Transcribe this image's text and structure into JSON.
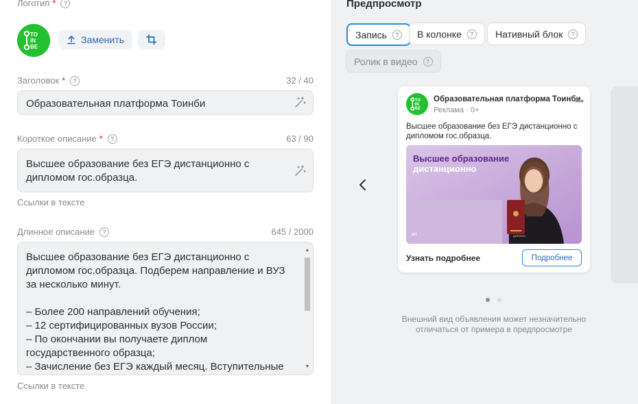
{
  "form": {
    "logo": {
      "label": "Логотип",
      "required_mark": "*",
      "replace_label": "Заменить",
      "logo_text": [
        "TO",
        "IN",
        "BE"
      ]
    },
    "title": {
      "label": "Заголовок",
      "required_mark": "*",
      "counter": "32 / 40",
      "value": "Образовательная платформа Тоинби"
    },
    "short": {
      "label": "Короткое описание",
      "required_mark": "*",
      "counter": "63 / 90",
      "value_lines": [
        "Высшее образование без ЕГЭ дистанционно с",
        "дипломом гос.образца."
      ],
      "links_label": "Ссылки в тексте"
    },
    "long": {
      "label": "Длинное описание",
      "counter": "645 / 2000",
      "value_lines": [
        "Высшее образование без ЕГЭ дистанционно с",
        "дипломом гос.образца. Подберем направление и ВУЗ",
        "за несколько минут.",
        "",
        "– Более 200 направлений обучения;",
        "– 12 сертифицированных вузов России;",
        "– По окончании вы получаете диплом",
        "государственного образца;",
        "– Зачисление без ЕГЭ каждый месяц. Вступительные"
      ],
      "links_label": "Ссылки в тексте"
    },
    "help_glyph": "?"
  },
  "preview": {
    "title": "Предпросмотр",
    "tabs": [
      {
        "label": "Запись",
        "active": true
      },
      {
        "label": "В колонке",
        "active": false
      },
      {
        "label": "Нативный блок",
        "active": false
      },
      {
        "label": "Ролик в видео",
        "active": false,
        "disabled": true
      }
    ],
    "card": {
      "advertiser": "Образовательная платформа Тоинби",
      "meta": "Реклама · 0+",
      "more_glyph": "•••",
      "text": "Высшее образование без ЕГЭ дистанционно с дипломом гос.образца.",
      "image_caption_lines": [
        "Высшее образование",
        "дистанционно"
      ],
      "image_mark": "ап",
      "cta_text": "Узнать подробнее",
      "cta_button": "Подробнее"
    },
    "pagination": {
      "count": 2,
      "active": 0
    },
    "disclaimer_lines": [
      "Внешний вид объявления может незначительно",
      "отличаться от примера в предпросмотре"
    ]
  },
  "colors": {
    "brand_green": "#23c130",
    "accent_blue": "#2688eb",
    "link_blue": "#2c6eb8",
    "required_red": "#ed0a34",
    "image_purple": "#c8a9d8"
  }
}
